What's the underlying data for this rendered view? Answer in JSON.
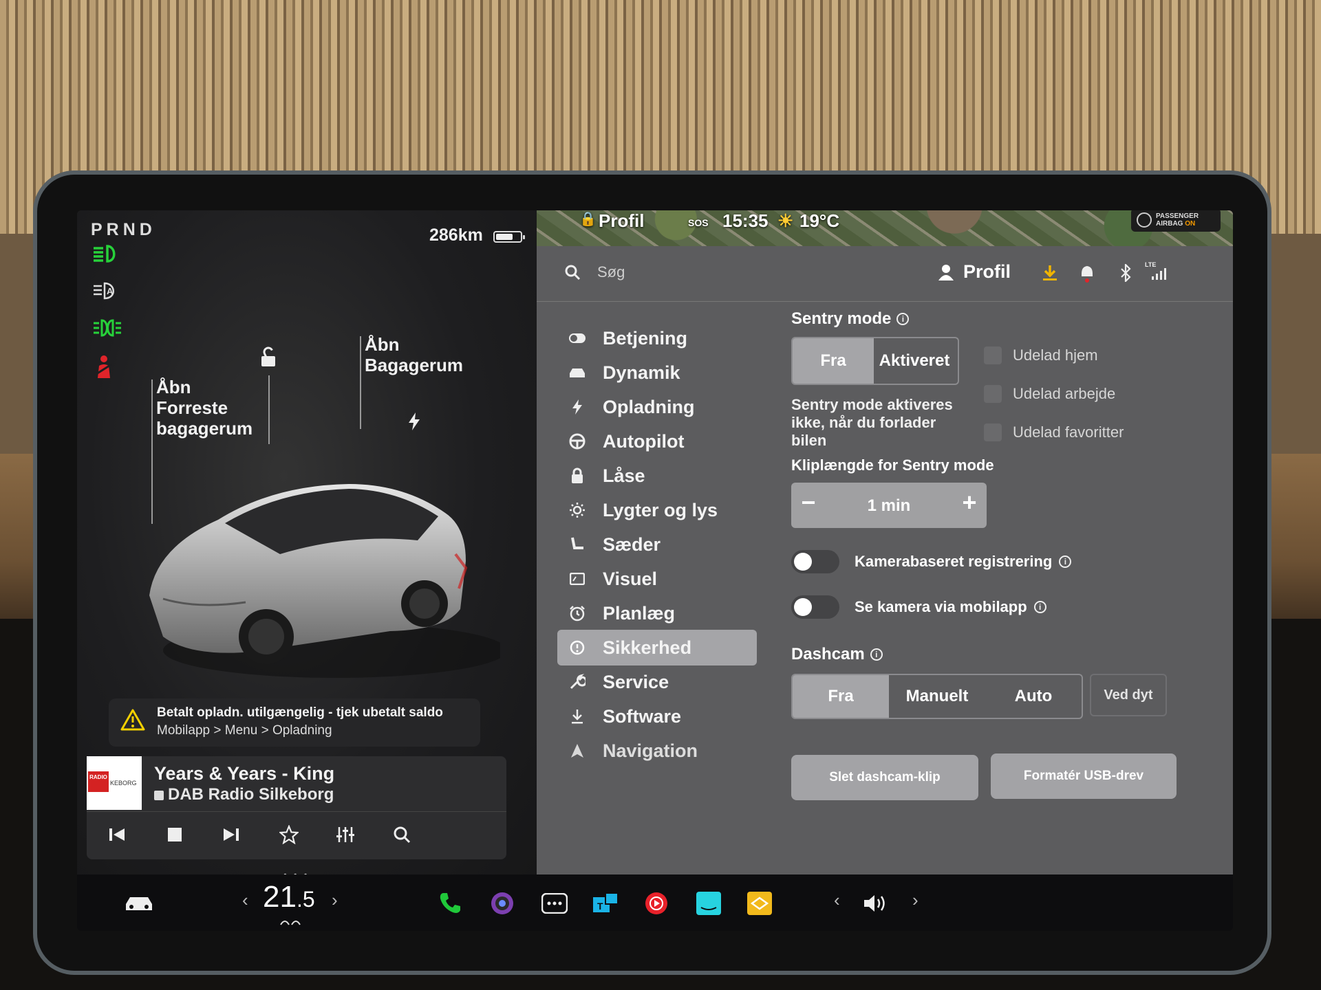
{
  "car_panel": {
    "gear": "PRND",
    "range": "286km",
    "battery_level": 0.7,
    "front_trunk_label": "Åbn\nForreste\nbagagerum",
    "rear_trunk_label": "Åbn\nBagagerum"
  },
  "warning": {
    "line1": "Betalt opladn. utilgængelig - tjek ubetalt saldo",
    "line2": "Mobilapp > Menu > Opladning"
  },
  "media": {
    "song": "Years & Years - King",
    "station": "DAB Radio Silkeborg",
    "art_text_top": "RADIO",
    "art_text_bottom": "KEBORG"
  },
  "map_strip": {
    "profile": "Profil",
    "time": "15:35",
    "temp": "19°C",
    "sos": "SOS",
    "airbag_line1": "PASSENGER",
    "airbag_line2": "AIRBAG",
    "airbag_status": "ON"
  },
  "topbar": {
    "search_placeholder": "Søg",
    "profile": "Profil",
    "lte": "LTE"
  },
  "menu": [
    {
      "label": "Betjening",
      "icon": "toggle-icon"
    },
    {
      "label": "Dynamik",
      "icon": "car-icon"
    },
    {
      "label": "Opladning",
      "icon": "bolt-icon"
    },
    {
      "label": "Autopilot",
      "icon": "steering-wheel-icon"
    },
    {
      "label": "Låse",
      "icon": "lock-icon"
    },
    {
      "label": "Lygter og lys",
      "icon": "sun-icon"
    },
    {
      "label": "Sæder",
      "icon": "seat-icon"
    },
    {
      "label": "Visuel",
      "icon": "display-icon"
    },
    {
      "label": "Planlæg",
      "icon": "alarm-clock-icon"
    },
    {
      "label": "Sikkerhed",
      "icon": "info-circle-icon",
      "active": true
    },
    {
      "label": "Service",
      "icon": "wrench-icon"
    },
    {
      "label": "Software",
      "icon": "download-icon"
    },
    {
      "label": "Navigation",
      "icon": "navigation-arrow-icon"
    }
  ],
  "sentry": {
    "title": "Sentry mode",
    "options": [
      "Fra",
      "Aktiveret"
    ],
    "selected": "Fra",
    "description": "Sentry mode aktiveres\nikke, når du forlader\nbilen",
    "exclusions": [
      "Udelad hjem",
      "Udelad arbejde",
      "Udelad favoritter"
    ],
    "clip_title": "Kliplængde for Sentry mode",
    "clip_value": "1 min",
    "minus": "−",
    "plus": "+"
  },
  "toggles": [
    {
      "label": "Kamerabaseret registrering",
      "on": false
    },
    {
      "label": "Se kamera via mobilapp",
      "on": false
    }
  ],
  "dashcam": {
    "title": "Dashcam",
    "options": [
      "Fra",
      "Manuelt",
      "Auto"
    ],
    "selected": "Fra",
    "extra_option": "Ved dyt",
    "delete_button": "Slet dashcam-klip",
    "format_button": "Formatér USB-drev"
  },
  "dock": {
    "temp_whole": "21",
    "temp_decimal": ".5"
  },
  "colors": {
    "indicator_green": "#27d13a",
    "seatbelt_red": "#e0242a",
    "download_yellow": "#f0b400",
    "phone_green": "#20c83a"
  },
  "info_glyph": "i",
  "page_dots": "• • •"
}
